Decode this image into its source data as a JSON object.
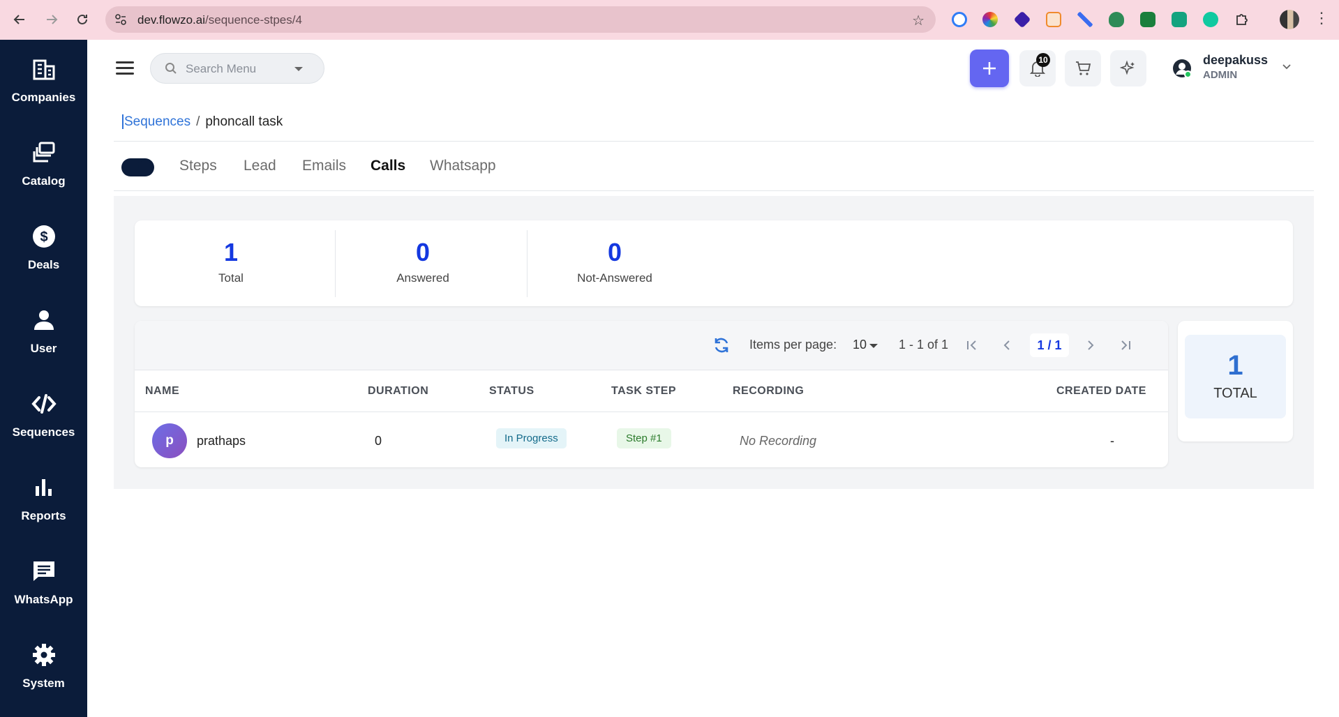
{
  "browser": {
    "url_host": "dev.flowzo.ai",
    "url_path": "/sequence-stpes/4"
  },
  "sidebar": {
    "items": [
      {
        "label": "Companies",
        "icon": "building-icon"
      },
      {
        "label": "Catalog",
        "icon": "layers-icon"
      },
      {
        "label": "Deals",
        "icon": "dollar-icon"
      },
      {
        "label": "User",
        "icon": "person-icon"
      },
      {
        "label": "Sequences",
        "icon": "code-icon"
      },
      {
        "label": "Reports",
        "icon": "bar-chart-icon"
      },
      {
        "label": "WhatsApp",
        "icon": "chat-icon"
      },
      {
        "label": "System",
        "icon": "gear-icon"
      }
    ]
  },
  "topbar": {
    "search_placeholder": "Search Menu",
    "notification_count": "10",
    "user_name": "deepakuss",
    "user_role": "ADMIN"
  },
  "breadcrumb": {
    "parent": "Sequences",
    "separator": "/",
    "current": "phoncall task"
  },
  "tabs": [
    "Steps",
    "Lead",
    "Emails",
    "Calls",
    "Whatsapp"
  ],
  "active_tab": "Calls",
  "stats": [
    {
      "value": "1",
      "label": "Total"
    },
    {
      "value": "0",
      "label": "Answered"
    },
    {
      "value": "0",
      "label": "Not-Answered"
    }
  ],
  "pagination": {
    "items_per_page_label": "Items per page:",
    "items_per_page": "10",
    "range": "1 - 1 of 1",
    "page": "1 / 1"
  },
  "table": {
    "columns": [
      "NAME",
      "DURATION",
      "STATUS",
      "TASK STEP",
      "RECORDING",
      "CREATED DATE"
    ],
    "rows": [
      {
        "avatar": "p",
        "name": "prathaps",
        "duration": "0",
        "status": "In Progress",
        "task_step": "Step #1",
        "recording": "No Recording",
        "created": "-"
      }
    ]
  },
  "total_card": {
    "value": "1",
    "label": "TOTAL"
  },
  "colors": {
    "sidebar_bg": "#0b1c3a",
    "accent": "#6466f1",
    "stat_number": "#1438e0",
    "browser_bar": "#f9d9e1"
  }
}
